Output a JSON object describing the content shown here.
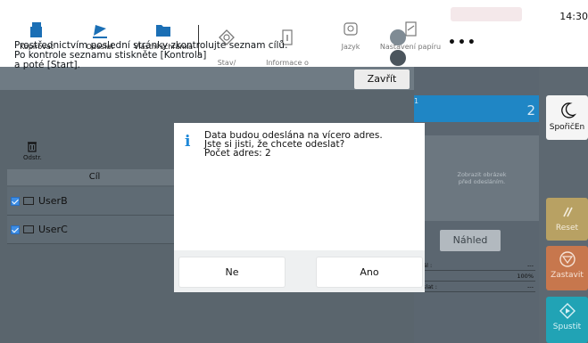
{
  "status": {
    "clock": "14:30"
  },
  "toolbar": {
    "items": [
      {
        "label": "Kopírovat",
        "icon": "copy-icon"
      },
      {
        "label": "Odeslat",
        "icon": "send-icon"
      },
      {
        "label": "Vlastní schránka",
        "icon": "folder-icon"
      },
      {
        "label": "Stav/\nZrušit úlohu",
        "icon": "job-status-icon"
      },
      {
        "label": "Informace o\nzařízení",
        "icon": "device-info-icon"
      },
      {
        "label": "Jazyk",
        "icon": "language-icon"
      },
      {
        "label": "Nastavení papíru",
        "icon": "paper-settings-icon"
      }
    ],
    "more": "•••"
  },
  "panel": {
    "close_label": "Zavřít",
    "message": "Prostřednictvím poslední stránky zkontrolujte seznam cílů.\nPo kontrole seznamu stiskněte [Kontrola]\na poté [Start].",
    "delete_label": "Odstr.",
    "column_header": "Cíl",
    "rows": [
      {
        "name": "UserB"
      },
      {
        "name": "UserC"
      }
    ]
  },
  "preview": {
    "strip_small": "1",
    "strip_number": "2",
    "text": "Zobrazit obrázek\npřed odesláním.",
    "button": "Náhled",
    "stats": [
      {
        "label": "nál :",
        "value": "---"
      },
      {
        "label": ":",
        "value": "100%"
      },
      {
        "label": "eslat :",
        "value": "---"
      }
    ]
  },
  "side": {
    "sleep": "SpořičEn",
    "reset": "Reset",
    "stop": "Zastavit",
    "start": "Spustit"
  },
  "dialog": {
    "line1": "Data budou odeslána na vícero adres.",
    "line2": "Jste si jisti, že chcete odeslat?",
    "line3": "Počet adres: 2",
    "no": "Ne",
    "yes": "Ano"
  },
  "colors": {
    "accent": "#1f86c5",
    "reset": "#b8a163",
    "stop": "#c7774d",
    "start": "#21a3b5",
    "dialog_icon": "#1e88d8"
  }
}
